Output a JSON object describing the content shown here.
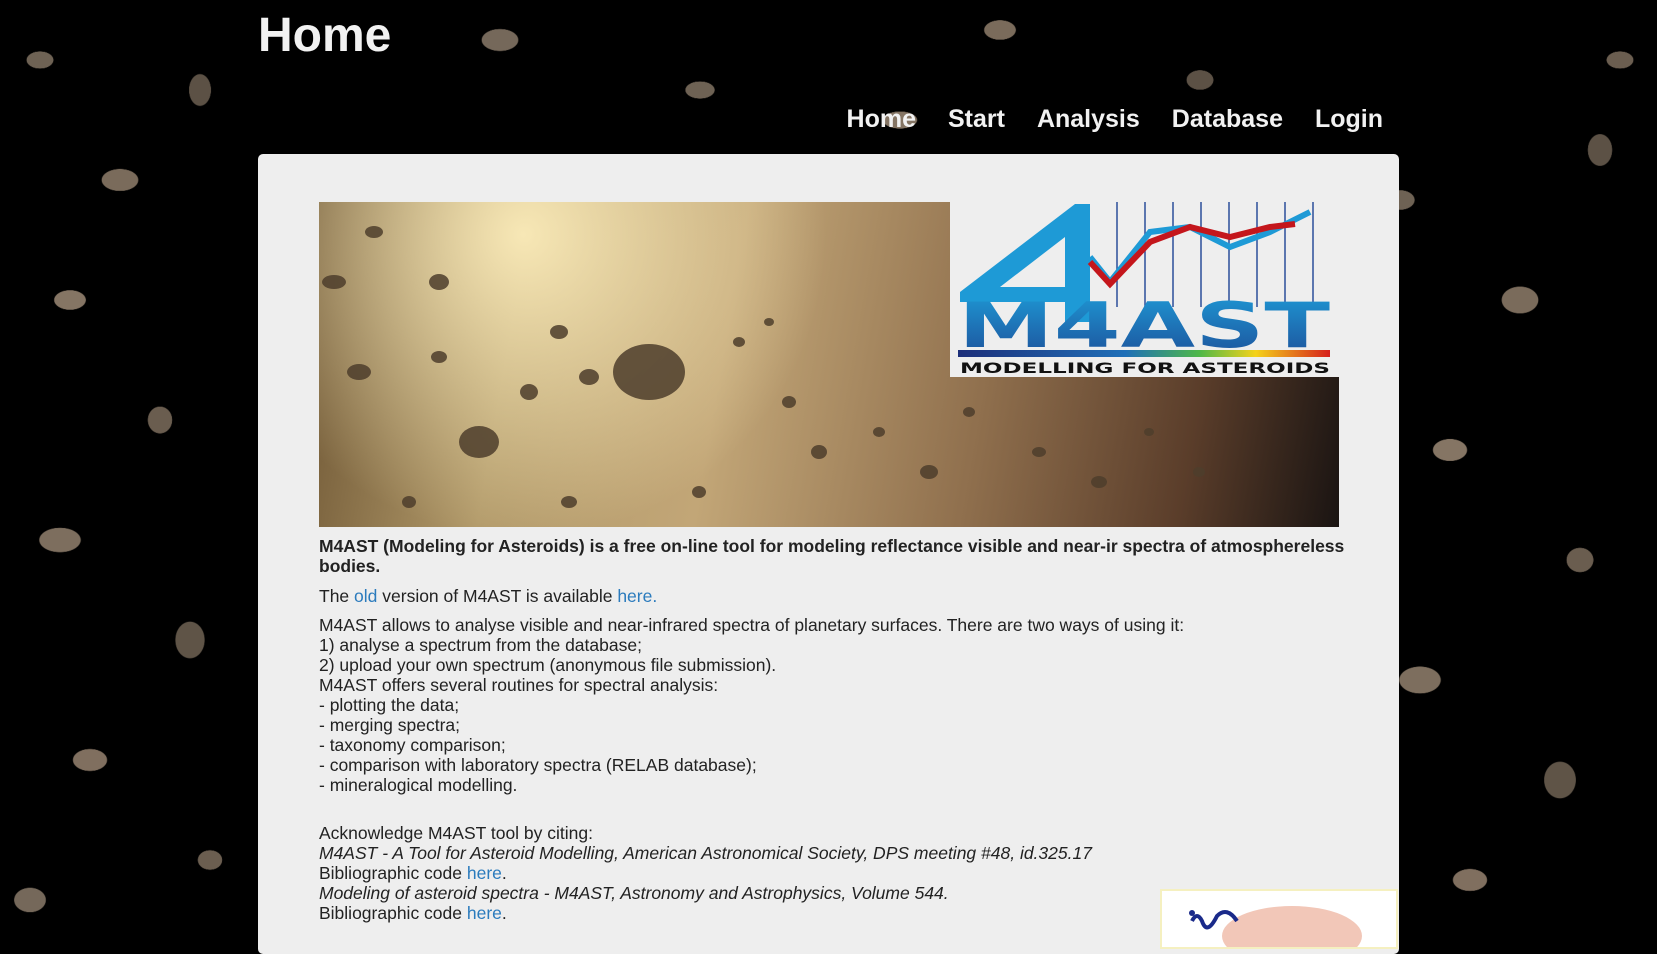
{
  "page": {
    "title": "Home"
  },
  "nav": {
    "items": [
      "Home",
      "Start",
      "Analysis",
      "Database",
      "Login"
    ]
  },
  "logo": {
    "big_text": "M4AST",
    "tagline": "MODELLING FOR ASTEROIDS",
    "colors": {
      "blue": "#1e9ad6",
      "red": "#c4161c"
    }
  },
  "intro": {
    "lead": "M4AST (Modeling for Asteroids) is a free on-line tool for modeling reflectance visible and near-ir spectra of atmosphereless bodies.",
    "old_prefix": "The ",
    "old_link": "old",
    "old_middle": " version of M4AST is available ",
    "old_here": "here."
  },
  "description": [
    "M4AST allows to analyse visible and near-infrared spectra of planetary surfaces. There are two ways of using it:",
    "1) analyse a spectrum from the database;",
    "2) upload your own spectrum (anonymous file submission).",
    "M4AST offers several routines for spectral analysis:",
    "- plotting the data;",
    "- merging spectra;",
    "- taxonomy comparison;",
    "- comparison with laboratory spectra (RELAB database);",
    "- mineralogical modelling."
  ],
  "citations": {
    "heading": "Acknowledge M4AST tool by citing:",
    "items": [
      {
        "title": "M4AST - A Tool for Asteroid Modelling, American Astronomical Society, DPS meeting #48, id.325.17",
        "code_label": "Bibliographic code ",
        "link": "here",
        "suffix": "."
      },
      {
        "title": "Modeling of asteroid spectra - M4AST, Astronomy and Astrophysics, Volume 544.",
        "code_label": "Bibliographic code ",
        "link": "here",
        "suffix": "."
      }
    ]
  },
  "colors": {
    "link": "#2b7bbd",
    "panel_bg": "#eeeeee",
    "text": "#222222"
  }
}
